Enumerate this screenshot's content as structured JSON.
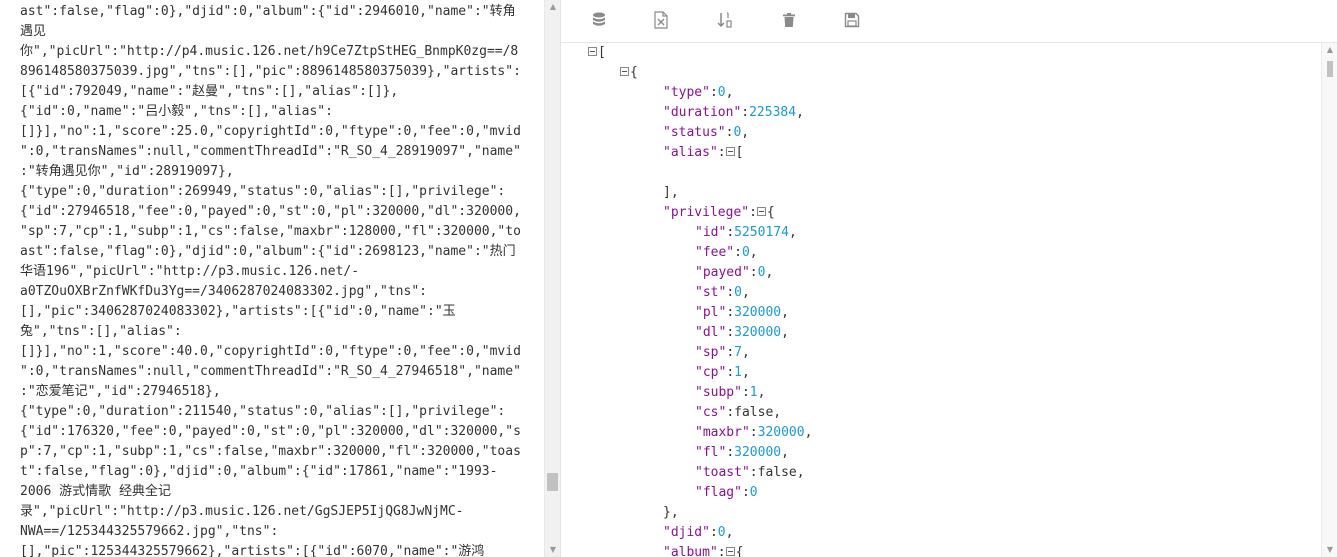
{
  "raw_lines": [
    "ast\":false,\"flag\":0},\"djid\":0,\"album\":{\"id\":2946010,\"name\":\"转角",
    "遇见",
    "你\",\"picUrl\":\"http://p4.music.126.net/h9Ce7ZtpStHEG_BnmpK0zg==/8",
    "896148580375039.jpg\",\"tns\":[],\"pic\":8896148580375039},\"artists\":",
    "[{\"id\":792049,\"name\":\"赵曼\",\"tns\":[],\"alias\":[]},",
    "{\"id\":0,\"name\":\"吕小毅\",\"tns\":[],\"alias\":",
    "[]}],\"no\":1,\"score\":25.0,\"copyrightId\":0,\"ftype\":0,\"fee\":0,\"mvid",
    "\":0,\"transNames\":null,\"commentThreadId\":\"R_SO_4_28919097\",\"name\"",
    ":\"转角遇见你\",\"id\":28919097},",
    "{\"type\":0,\"duration\":269949,\"status\":0,\"alias\":[],\"privilege\":",
    "{\"id\":27946518,\"fee\":0,\"payed\":0,\"st\":0,\"pl\":320000,\"dl\":320000,",
    "\"sp\":7,\"cp\":1,\"subp\":1,\"cs\":false,\"maxbr\":128000,\"fl\":320000,\"to",
    "ast\":false,\"flag\":0},\"djid\":0,\"album\":{\"id\":2698123,\"name\":\"热门",
    "华语196\",\"picUrl\":\"http://p3.music.126.net/-",
    "a0TZOuOXBrZnfWKfDu3Yg==/3406287024083302.jpg\",\"tns\":",
    "[],\"pic\":3406287024083302},\"artists\":[{\"id\":0,\"name\":\"玉",
    "兔\",\"tns\":[],\"alias\":",
    "[]}],\"no\":1,\"score\":40.0,\"copyrightId\":0,\"ftype\":0,\"fee\":0,\"mvid",
    "\":0,\"transNames\":null,\"commentThreadId\":\"R_SO_4_27946518\",\"name\"",
    ":\"恋爱笔记\",\"id\":27946518},",
    "{\"type\":0,\"duration\":211540,\"status\":0,\"alias\":[],\"privilege\":",
    "{\"id\":176320,\"fee\":0,\"payed\":0,\"st\":0,\"pl\":320000,\"dl\":320000,\"s",
    "p\":7,\"cp\":1,\"subp\":1,\"cs\":false,\"maxbr\":320000,\"fl\":320000,\"toas",
    "t\":false,\"flag\":0},\"djid\":0,\"album\":{\"id\":17861,\"name\":\"1993-",
    "2006 游式情歌 经典全记",
    "录\",\"picUrl\":\"http://p3.music.126.net/GgSJEP5IjQG8JwNjMC-",
    "NWA==/125344325579662.jpg\",\"tns\":",
    "[],\"pic\":125344325579662},\"artists\":[{\"id\":6070,\"name\":\"游鸿"
  ],
  "toolbar": {
    "database_icon": "database-icon",
    "excel_icon": "excel-icon",
    "sort_icon": "sort-icon",
    "delete_icon": "trash-icon",
    "save_icon": "save-icon"
  },
  "json_tree": [
    {
      "indent": 0,
      "toggle": true,
      "parts": [
        {
          "t": "[",
          "c": "plain"
        }
      ]
    },
    {
      "indent": 1,
      "toggle": true,
      "parts": [
        {
          "t": "{",
          "c": "plain"
        }
      ]
    },
    {
      "indent": 2,
      "parts": [
        {
          "t": "\"type\"",
          "c": "key"
        },
        {
          "t": ":",
          "c": "plain"
        },
        {
          "t": "0",
          "c": "num"
        },
        {
          "t": ",",
          "c": "plain"
        }
      ]
    },
    {
      "indent": 2,
      "parts": [
        {
          "t": "\"duration\"",
          "c": "key"
        },
        {
          "t": ":",
          "c": "plain"
        },
        {
          "t": "225384",
          "c": "num"
        },
        {
          "t": ",",
          "c": "plain"
        }
      ]
    },
    {
      "indent": 2,
      "parts": [
        {
          "t": "\"status\"",
          "c": "key"
        },
        {
          "t": ":",
          "c": "plain"
        },
        {
          "t": "0",
          "c": "num"
        },
        {
          "t": ",",
          "c": "plain"
        }
      ]
    },
    {
      "indent": 2,
      "parts": [
        {
          "t": "\"alias\"",
          "c": "key"
        },
        {
          "t": ":",
          "c": "plain"
        },
        {
          "toggle": true
        },
        {
          "t": "[",
          "c": "plain"
        }
      ]
    },
    {
      "indent": 2,
      "parts": []
    },
    {
      "indent": 2,
      "parts": [
        {
          "t": "],",
          "c": "plain"
        }
      ]
    },
    {
      "indent": 2,
      "parts": [
        {
          "t": "\"privilege\"",
          "c": "key"
        },
        {
          "t": ":",
          "c": "plain"
        },
        {
          "toggle": true
        },
        {
          "t": "{",
          "c": "plain"
        }
      ]
    },
    {
      "indent": 3,
      "parts": [
        {
          "t": "\"id\"",
          "c": "key"
        },
        {
          "t": ":",
          "c": "plain"
        },
        {
          "t": "5250174",
          "c": "num"
        },
        {
          "t": ",",
          "c": "plain"
        }
      ]
    },
    {
      "indent": 3,
      "parts": [
        {
          "t": "\"fee\"",
          "c": "key"
        },
        {
          "t": ":",
          "c": "plain"
        },
        {
          "t": "0",
          "c": "num"
        },
        {
          "t": ",",
          "c": "plain"
        }
      ]
    },
    {
      "indent": 3,
      "parts": [
        {
          "t": "\"payed\"",
          "c": "key"
        },
        {
          "t": ":",
          "c": "plain"
        },
        {
          "t": "0",
          "c": "num"
        },
        {
          "t": ",",
          "c": "plain"
        }
      ]
    },
    {
      "indent": 3,
      "parts": [
        {
          "t": "\"st\"",
          "c": "key"
        },
        {
          "t": ":",
          "c": "plain"
        },
        {
          "t": "0",
          "c": "num"
        },
        {
          "t": ",",
          "c": "plain"
        }
      ]
    },
    {
      "indent": 3,
      "parts": [
        {
          "t": "\"pl\"",
          "c": "key"
        },
        {
          "t": ":",
          "c": "plain"
        },
        {
          "t": "320000",
          "c": "num"
        },
        {
          "t": ",",
          "c": "plain"
        }
      ]
    },
    {
      "indent": 3,
      "parts": [
        {
          "t": "\"dl\"",
          "c": "key"
        },
        {
          "t": ":",
          "c": "plain"
        },
        {
          "t": "320000",
          "c": "num"
        },
        {
          "t": ",",
          "c": "plain"
        }
      ]
    },
    {
      "indent": 3,
      "parts": [
        {
          "t": "\"sp\"",
          "c": "key"
        },
        {
          "t": ":",
          "c": "plain"
        },
        {
          "t": "7",
          "c": "num"
        },
        {
          "t": ",",
          "c": "plain"
        }
      ]
    },
    {
      "indent": 3,
      "parts": [
        {
          "t": "\"cp\"",
          "c": "key"
        },
        {
          "t": ":",
          "c": "plain"
        },
        {
          "t": "1",
          "c": "num"
        },
        {
          "t": ",",
          "c": "plain"
        }
      ]
    },
    {
      "indent": 3,
      "parts": [
        {
          "t": "\"subp\"",
          "c": "key"
        },
        {
          "t": ":",
          "c": "plain"
        },
        {
          "t": "1",
          "c": "num"
        },
        {
          "t": ",",
          "c": "plain"
        }
      ]
    },
    {
      "indent": 3,
      "parts": [
        {
          "t": "\"cs\"",
          "c": "key"
        },
        {
          "t": ":false,",
          "c": "plain"
        }
      ]
    },
    {
      "indent": 3,
      "parts": [
        {
          "t": "\"maxbr\"",
          "c": "key"
        },
        {
          "t": ":",
          "c": "plain"
        },
        {
          "t": "320000",
          "c": "num"
        },
        {
          "t": ",",
          "c": "plain"
        }
      ]
    },
    {
      "indent": 3,
      "parts": [
        {
          "t": "\"fl\"",
          "c": "key"
        },
        {
          "t": ":",
          "c": "plain"
        },
        {
          "t": "320000",
          "c": "num"
        },
        {
          "t": ",",
          "c": "plain"
        }
      ]
    },
    {
      "indent": 3,
      "parts": [
        {
          "t": "\"toast\"",
          "c": "key"
        },
        {
          "t": ":false,",
          "c": "plain"
        }
      ]
    },
    {
      "indent": 3,
      "parts": [
        {
          "t": "\"flag\"",
          "c": "key"
        },
        {
          "t": ":",
          "c": "plain"
        },
        {
          "t": "0",
          "c": "num"
        }
      ]
    },
    {
      "indent": 2,
      "parts": [
        {
          "t": "},",
          "c": "plain"
        }
      ]
    },
    {
      "indent": 2,
      "parts": [
        {
          "t": "\"djid\"",
          "c": "key"
        },
        {
          "t": ":",
          "c": "plain"
        },
        {
          "t": "0",
          "c": "num"
        },
        {
          "t": ",",
          "c": "plain"
        }
      ]
    },
    {
      "indent": 2,
      "parts": [
        {
          "t": "\"album\"",
          "c": "key"
        },
        {
          "t": ":",
          "c": "plain"
        },
        {
          "toggle": true
        },
        {
          "t": "{",
          "c": "plain"
        }
      ]
    }
  ],
  "colors": {
    "key": "#881391",
    "number": "#1a9bd7",
    "text": "#333333",
    "toolbar_icon": "#8a8a8a"
  }
}
